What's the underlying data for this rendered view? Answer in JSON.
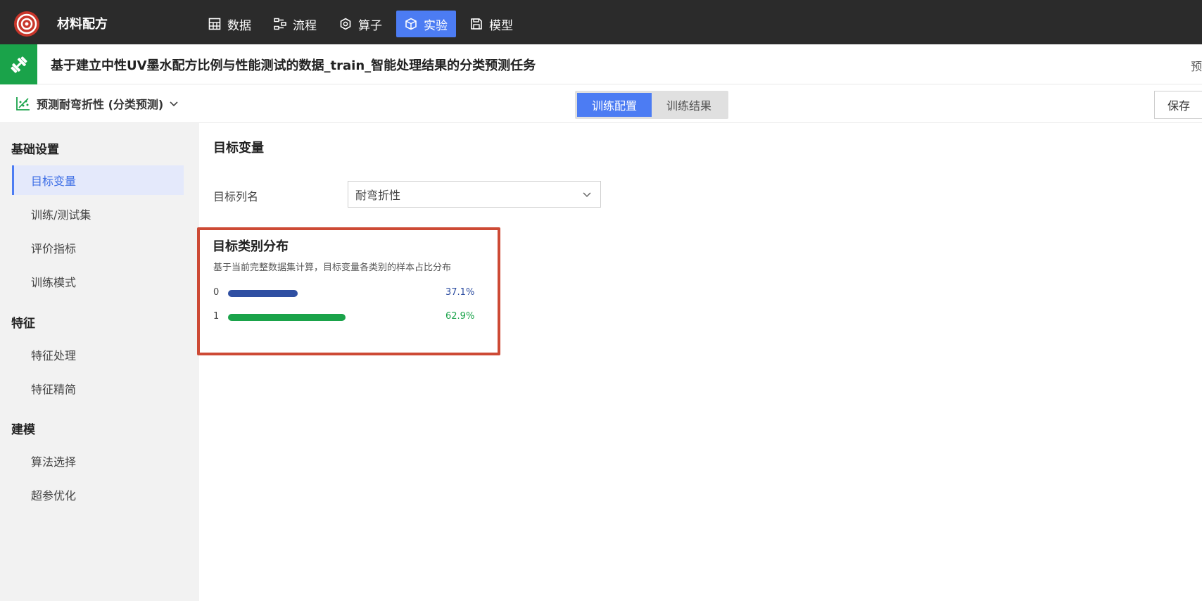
{
  "app": {
    "name": "材料配方"
  },
  "nav": [
    {
      "label": "数据",
      "icon": "table-icon",
      "active": false
    },
    {
      "label": "流程",
      "icon": "flow-icon",
      "active": false
    },
    {
      "label": "算子",
      "icon": "hexagon-icon",
      "active": false
    },
    {
      "label": "实验",
      "icon": "cube-icon",
      "active": true
    },
    {
      "label": "模型",
      "icon": "save-icon",
      "active": false
    }
  ],
  "page": {
    "title": "基于建立中性UV墨水配方比例与性能测试的数据_train_智能处理结果的分类预测任务",
    "right_cut": "预"
  },
  "toolbar": {
    "task": "预测耐弯折性 (分类预测)",
    "tabs": [
      "训练配置",
      "训练结果"
    ],
    "active_tab": 0,
    "save": "保存"
  },
  "sidebar": {
    "groups": [
      {
        "label": "基础设置",
        "items": [
          "目标变量",
          "训练/测试集",
          "评价指标",
          "训练模式"
        ]
      },
      {
        "label": "特征",
        "items": [
          "特征处理",
          "特征精简"
        ]
      },
      {
        "label": "建模",
        "items": [
          "算法选择",
          "超参优化"
        ]
      }
    ],
    "active_item": "目标变量"
  },
  "main": {
    "section_title": "目标变量",
    "target_label": "目标列名",
    "target_value": "耐弯折性",
    "distribution": {
      "title": "目标类别分布",
      "desc": "基于当前完整数据集计算，目标变量各类别的样本占比分布",
      "rows": [
        {
          "label": "0",
          "value": 37.1,
          "pct": "37.1%",
          "color": "#2f4fa2"
        },
        {
          "label": "1",
          "value": 62.9,
          "pct": "62.9%",
          "color": "#1aa34a"
        }
      ]
    }
  },
  "colors": {
    "accent": "#4c7cf3",
    "brand_green": "#1aa34a",
    "highlight_border": "#cd4a35"
  }
}
